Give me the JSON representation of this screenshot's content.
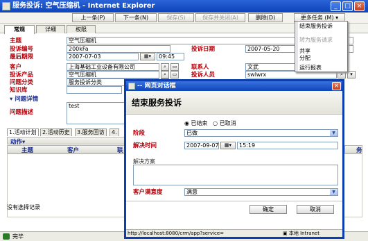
{
  "window": {
    "title": "服务投诉: 空气压缩机 - Internet Explorer",
    "min": "_",
    "max": "□",
    "close": "×"
  },
  "toolbar": {
    "prev": "上一条(P)",
    "next": "下一条(N)",
    "save": "保存(S)",
    "save_close": "保存并关闭(A)",
    "delete": "删除(D)",
    "more": "更多任务 (M) ▾"
  },
  "more_menu": {
    "items": [
      {
        "label": "结束服务投诉",
        "enabled": true
      },
      {
        "label": "转为服务请求",
        "enabled": false
      },
      {
        "label": "共享",
        "enabled": true
      },
      {
        "label": "分配",
        "enabled": true
      },
      {
        "label": "运行报表",
        "enabled": true
      }
    ]
  },
  "tabs": [
    "常规",
    "详细",
    "权限"
  ],
  "form": {
    "subject_label": "主题",
    "subject_value": "空气压缩机",
    "number_label": "投诉编号",
    "number_value": "200kFa",
    "date_label": "投诉日期",
    "date_value": "2007-05-20",
    "deadline_label": "最后期限",
    "deadline_date": "2007-07-03",
    "deadline_time": "09:45",
    "customer_label": "客户",
    "customer_value": "上海基础工业设备有限公司",
    "contact_label": "联系人",
    "contact_value": "文武",
    "product_label": "投诉产品",
    "product_value": "空气压缩机",
    "agent_label": "投诉人员",
    "agent_value": "swlwrx",
    "category_label": "问题分类",
    "category_value": "服务投诉分类",
    "kb_label": "知识库",
    "detail_section": "▾ 问题详情",
    "desc_label": "问题描述",
    "desc_value": "test"
  },
  "lower_tabs": [
    "1.活动计划",
    "2.活动历史",
    "3.服务回访",
    "4."
  ],
  "grid": {
    "action": "动作▾",
    "col_subject": "主题",
    "col_customer": "客户",
    "col_more": "联",
    "col_last": "务",
    "empty": "没有选择记录"
  },
  "statusbar": {
    "text": "完毕"
  },
  "dialog": {
    "title": "-- 网页对话框",
    "heading": "结束服务投诉",
    "radio_done": "已结束",
    "radio_cancel": "已取消",
    "stage_label": "阶段",
    "stage_value": "已做",
    "time_label": "解决时间",
    "time_date": "2007-09-07",
    "time_time": "15:19",
    "solution_label": "解决方案",
    "satisfaction_label": "客户满意度",
    "satisfaction_value": "满意",
    "ok": "确定",
    "cancel": "取消",
    "status_url": "http://localhost:8080/crm/app?service=",
    "status_zone": "本地 Intranet"
  }
}
